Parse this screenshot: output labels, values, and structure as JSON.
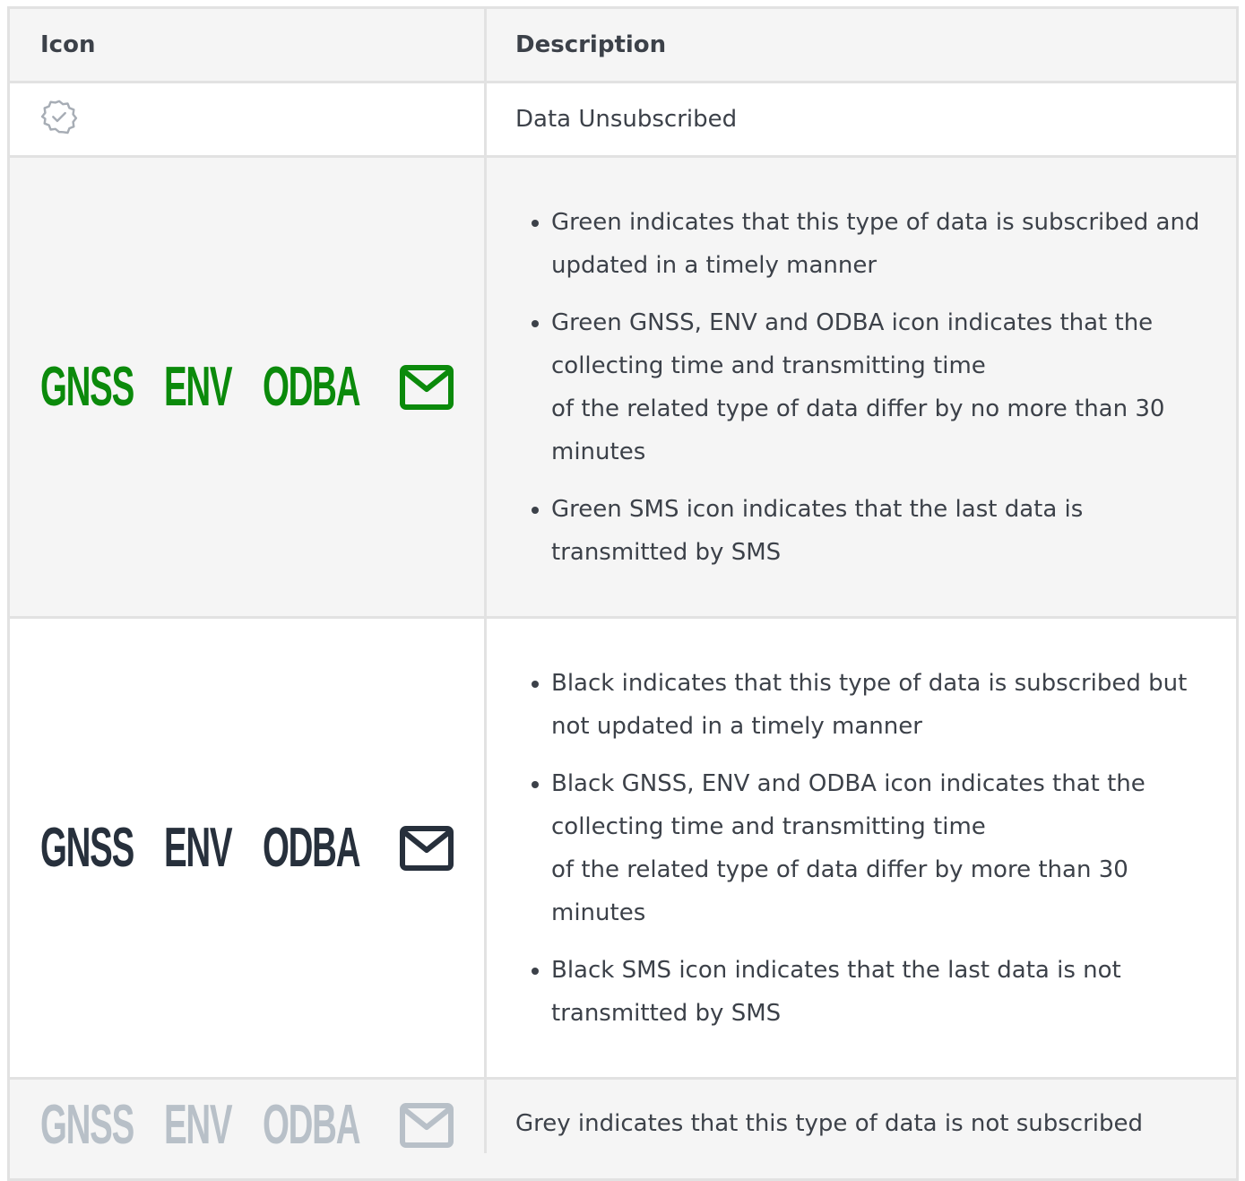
{
  "header": {
    "icon": "Icon",
    "description": "Description"
  },
  "rows": [
    {
      "icon": "badge-check-icon",
      "description": "Data Unsubscribed"
    },
    {
      "color": "#0b8a0b",
      "labels": [
        "GNSS",
        "ENV",
        "ODBA"
      ],
      "bullets": [
        "Green indicates that this type of data is subscribed and updated in a timely manner",
        "Green GNSS, ENV and ODBA icon indicates that the collecting time and transmitting time\nof the related type of data differ by no more than 30 minutes",
        "Green SMS icon indicates that the last data is transmitted by SMS"
      ]
    },
    {
      "color": "#27303c",
      "labels": [
        "GNSS",
        "ENV",
        "ODBA"
      ],
      "bullets": [
        "Black indicates that this type of data is subscribed but not updated in a timely manner",
        "Black GNSS, ENV and ODBA icon indicates that the collecting time and transmitting time\nof the related type of data differ by more than 30 minutes",
        "Black SMS icon indicates that the last data is not transmitted by SMS"
      ]
    },
    {
      "color": "#b8c0c8",
      "labels": [
        "GNSS",
        "ENV",
        "ODBA"
      ],
      "description": "Grey indicates that this type of data is not subscribed"
    }
  ]
}
